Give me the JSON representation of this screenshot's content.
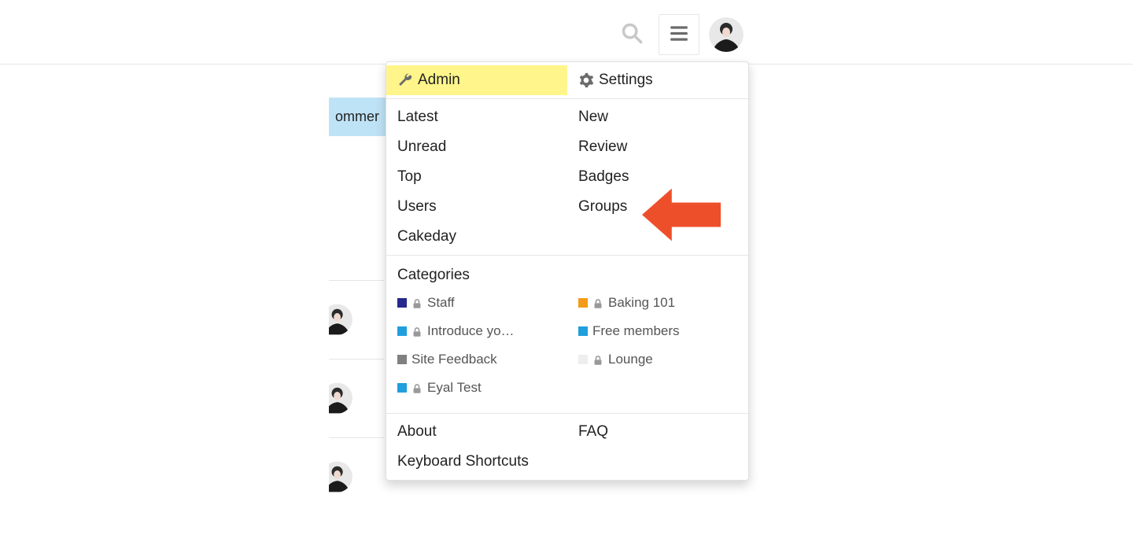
{
  "bg": {
    "token": "ommer",
    "avatars": 3
  },
  "menu": {
    "top_left": [
      {
        "key": "admin",
        "label": "Admin",
        "icon": "wrench",
        "highlight": true
      }
    ],
    "top_right": [
      {
        "key": "settings",
        "label": "Settings",
        "icon": "gear"
      }
    ],
    "left": [
      {
        "key": "latest",
        "label": "Latest"
      },
      {
        "key": "unread",
        "label": "Unread"
      },
      {
        "key": "top",
        "label": "Top"
      },
      {
        "key": "users",
        "label": "Users"
      },
      {
        "key": "cakeday",
        "label": "Cakeday"
      }
    ],
    "right": [
      {
        "key": "new",
        "label": "New"
      },
      {
        "key": "review",
        "label": "Review"
      },
      {
        "key": "badges",
        "label": "Badges"
      },
      {
        "key": "groups",
        "label": "Groups"
      }
    ],
    "categories_title": "Categories",
    "categories_left": [
      {
        "label": "Staff",
        "color": "#25288c",
        "locked": true
      },
      {
        "label": "Introduce yo…",
        "color": "#1f9fdc",
        "locked": true
      },
      {
        "label": "Site Feedback",
        "color": "#808080",
        "locked": false
      },
      {
        "label": "Eyal Test",
        "color": "#1f9fdc",
        "locked": true
      }
    ],
    "categories_right": [
      {
        "label": "Baking 101",
        "color": "#f39b1a",
        "locked": true
      },
      {
        "label": "Free members",
        "color": "#1f9fdc",
        "locked": false
      },
      {
        "label": "Lounge",
        "color": "#eeeeee",
        "locked": true
      }
    ],
    "footer_left": [
      {
        "key": "about",
        "label": "About"
      },
      {
        "key": "kbd",
        "label": "Keyboard Shortcuts"
      }
    ],
    "footer_right": [
      {
        "key": "faq",
        "label": "FAQ"
      }
    ]
  },
  "annotation": {
    "arrow_target": "groups",
    "arrow_color": "#ee4f2b"
  }
}
